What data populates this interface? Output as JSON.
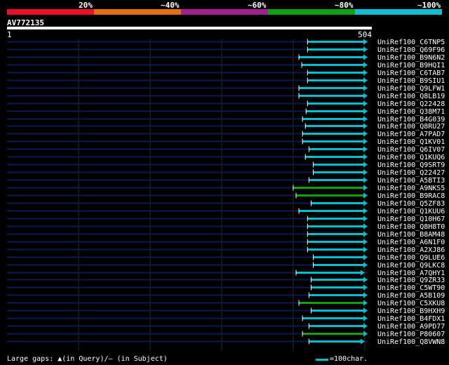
{
  "legend": [
    {
      "label": "20%",
      "color": "#e8102a"
    },
    {
      "label": "~40%",
      "color": "#e07010"
    },
    {
      "label": "~60%",
      "color": "#a02090"
    },
    {
      "label": "~80%",
      "color": "#10a010"
    },
    {
      "label": "~100%",
      "color": "#10c0d0"
    }
  ],
  "query": {
    "name": "AV772135",
    "start": "1",
    "end": "504",
    "length": 504
  },
  "footer": {
    "gaps_text": "Large gaps: ▲(in Query)/– (in Subject)",
    "scale_text": "=100char."
  },
  "colors": {
    "background": "#000000",
    "track": "#0c1a50",
    "grid": "#2a2a2a",
    "hit_cyan": "#00c0d0",
    "hit_green": "#10a010"
  },
  "hits": [
    {
      "name": "UniRef100_C6TNP5",
      "start": 420,
      "end": 504,
      "color": "cyan"
    },
    {
      "name": "UniRef100_Q69F96",
      "start": 420,
      "end": 504,
      "color": "cyan"
    },
    {
      "name": "UniRef100_B9N6N2",
      "start": 408,
      "end": 504,
      "color": "cyan"
    },
    {
      "name": "UniRef100_B9HQI1",
      "start": 412,
      "end": 504,
      "color": "cyan"
    },
    {
      "name": "UniRef100_C6TAB7",
      "start": 420,
      "end": 504,
      "color": "cyan"
    },
    {
      "name": "UniRef100_B9SIU1",
      "start": 420,
      "end": 504,
      "color": "cyan"
    },
    {
      "name": "UniRef100_Q9LFW1",
      "start": 408,
      "end": 504,
      "color": "cyan"
    },
    {
      "name": "UniRef100_Q8LB19",
      "start": 408,
      "end": 504,
      "color": "cyan"
    },
    {
      "name": "UniRef100_Q22428",
      "start": 420,
      "end": 504,
      "color": "cyan"
    },
    {
      "name": "UniRef100_Q38M71",
      "start": 418,
      "end": 504,
      "color": "cyan"
    },
    {
      "name": "UniRef100_B4G039",
      "start": 413,
      "end": 504,
      "color": "cyan"
    },
    {
      "name": "UniRef100_Q8RU27",
      "start": 417,
      "end": 504,
      "color": "cyan"
    },
    {
      "name": "UniRef100_A7PAD7",
      "start": 413,
      "end": 504,
      "color": "cyan"
    },
    {
      "name": "UniRef100_Q1KV01",
      "start": 413,
      "end": 504,
      "color": "cyan"
    },
    {
      "name": "UniRef100_Q6IV07",
      "start": 422,
      "end": 504,
      "color": "cyan"
    },
    {
      "name": "UniRef100_Q1KUQ6",
      "start": 417,
      "end": 504,
      "color": "cyan"
    },
    {
      "name": "UniRef100_Q9SRT9",
      "start": 428,
      "end": 504,
      "color": "cyan"
    },
    {
      "name": "UniRef100_Q22427",
      "start": 428,
      "end": 504,
      "color": "cyan"
    },
    {
      "name": "UniRef100_A5BTI3",
      "start": 422,
      "end": 504,
      "color": "cyan"
    },
    {
      "name": "UniRef100_A9NKS5",
      "start": 400,
      "end": 504,
      "color": "green"
    },
    {
      "name": "UniRef100_B9RAC8",
      "start": 404,
      "end": 504,
      "color": "green"
    },
    {
      "name": "UniRef100_Q5ZF83",
      "start": 425,
      "end": 504,
      "color": "cyan"
    },
    {
      "name": "UniRef100_Q1KUU6",
      "start": 408,
      "end": 504,
      "color": "cyan"
    },
    {
      "name": "UniRef100_Q10H67",
      "start": 420,
      "end": 504,
      "color": "cyan"
    },
    {
      "name": "UniRef100_Q8H8T0",
      "start": 420,
      "end": 504,
      "color": "cyan"
    },
    {
      "name": "UniRef100_B8AM48",
      "start": 420,
      "end": 504,
      "color": "cyan"
    },
    {
      "name": "UniRef100_A6N1F0",
      "start": 420,
      "end": 504,
      "color": "cyan"
    },
    {
      "name": "UniRef100_A2XJ86",
      "start": 420,
      "end": 504,
      "color": "cyan"
    },
    {
      "name": "UniRef100_Q9LUE6",
      "start": 428,
      "end": 504,
      "color": "cyan"
    },
    {
      "name": "UniRef100_Q9LKC8",
      "start": 428,
      "end": 504,
      "color": "cyan"
    },
    {
      "name": "UniRef100_A7QHY1",
      "start": 404,
      "end": 500,
      "color": "cyan"
    },
    {
      "name": "UniRef100_Q9ZR33",
      "start": 425,
      "end": 504,
      "color": "cyan"
    },
    {
      "name": "UniRef100_C5WT90",
      "start": 425,
      "end": 504,
      "color": "cyan"
    },
    {
      "name": "UniRef100_A5B109",
      "start": 422,
      "end": 504,
      "color": "cyan"
    },
    {
      "name": "UniRef100_C5XKU8",
      "start": 408,
      "end": 504,
      "color": "green"
    },
    {
      "name": "UniRef100_B9HXH9",
      "start": 425,
      "end": 504,
      "color": "cyan"
    },
    {
      "name": "UniRef100_B4FDX1",
      "start": 413,
      "end": 504,
      "color": "cyan"
    },
    {
      "name": "UniRef100_A9PD77",
      "start": 422,
      "end": 504,
      "color": "cyan"
    },
    {
      "name": "UniRef100_P80607",
      "start": 413,
      "end": 504,
      "color": "green"
    },
    {
      "name": "UniRef100_Q8VWN8",
      "start": 422,
      "end": 500,
      "color": "cyan"
    }
  ]
}
